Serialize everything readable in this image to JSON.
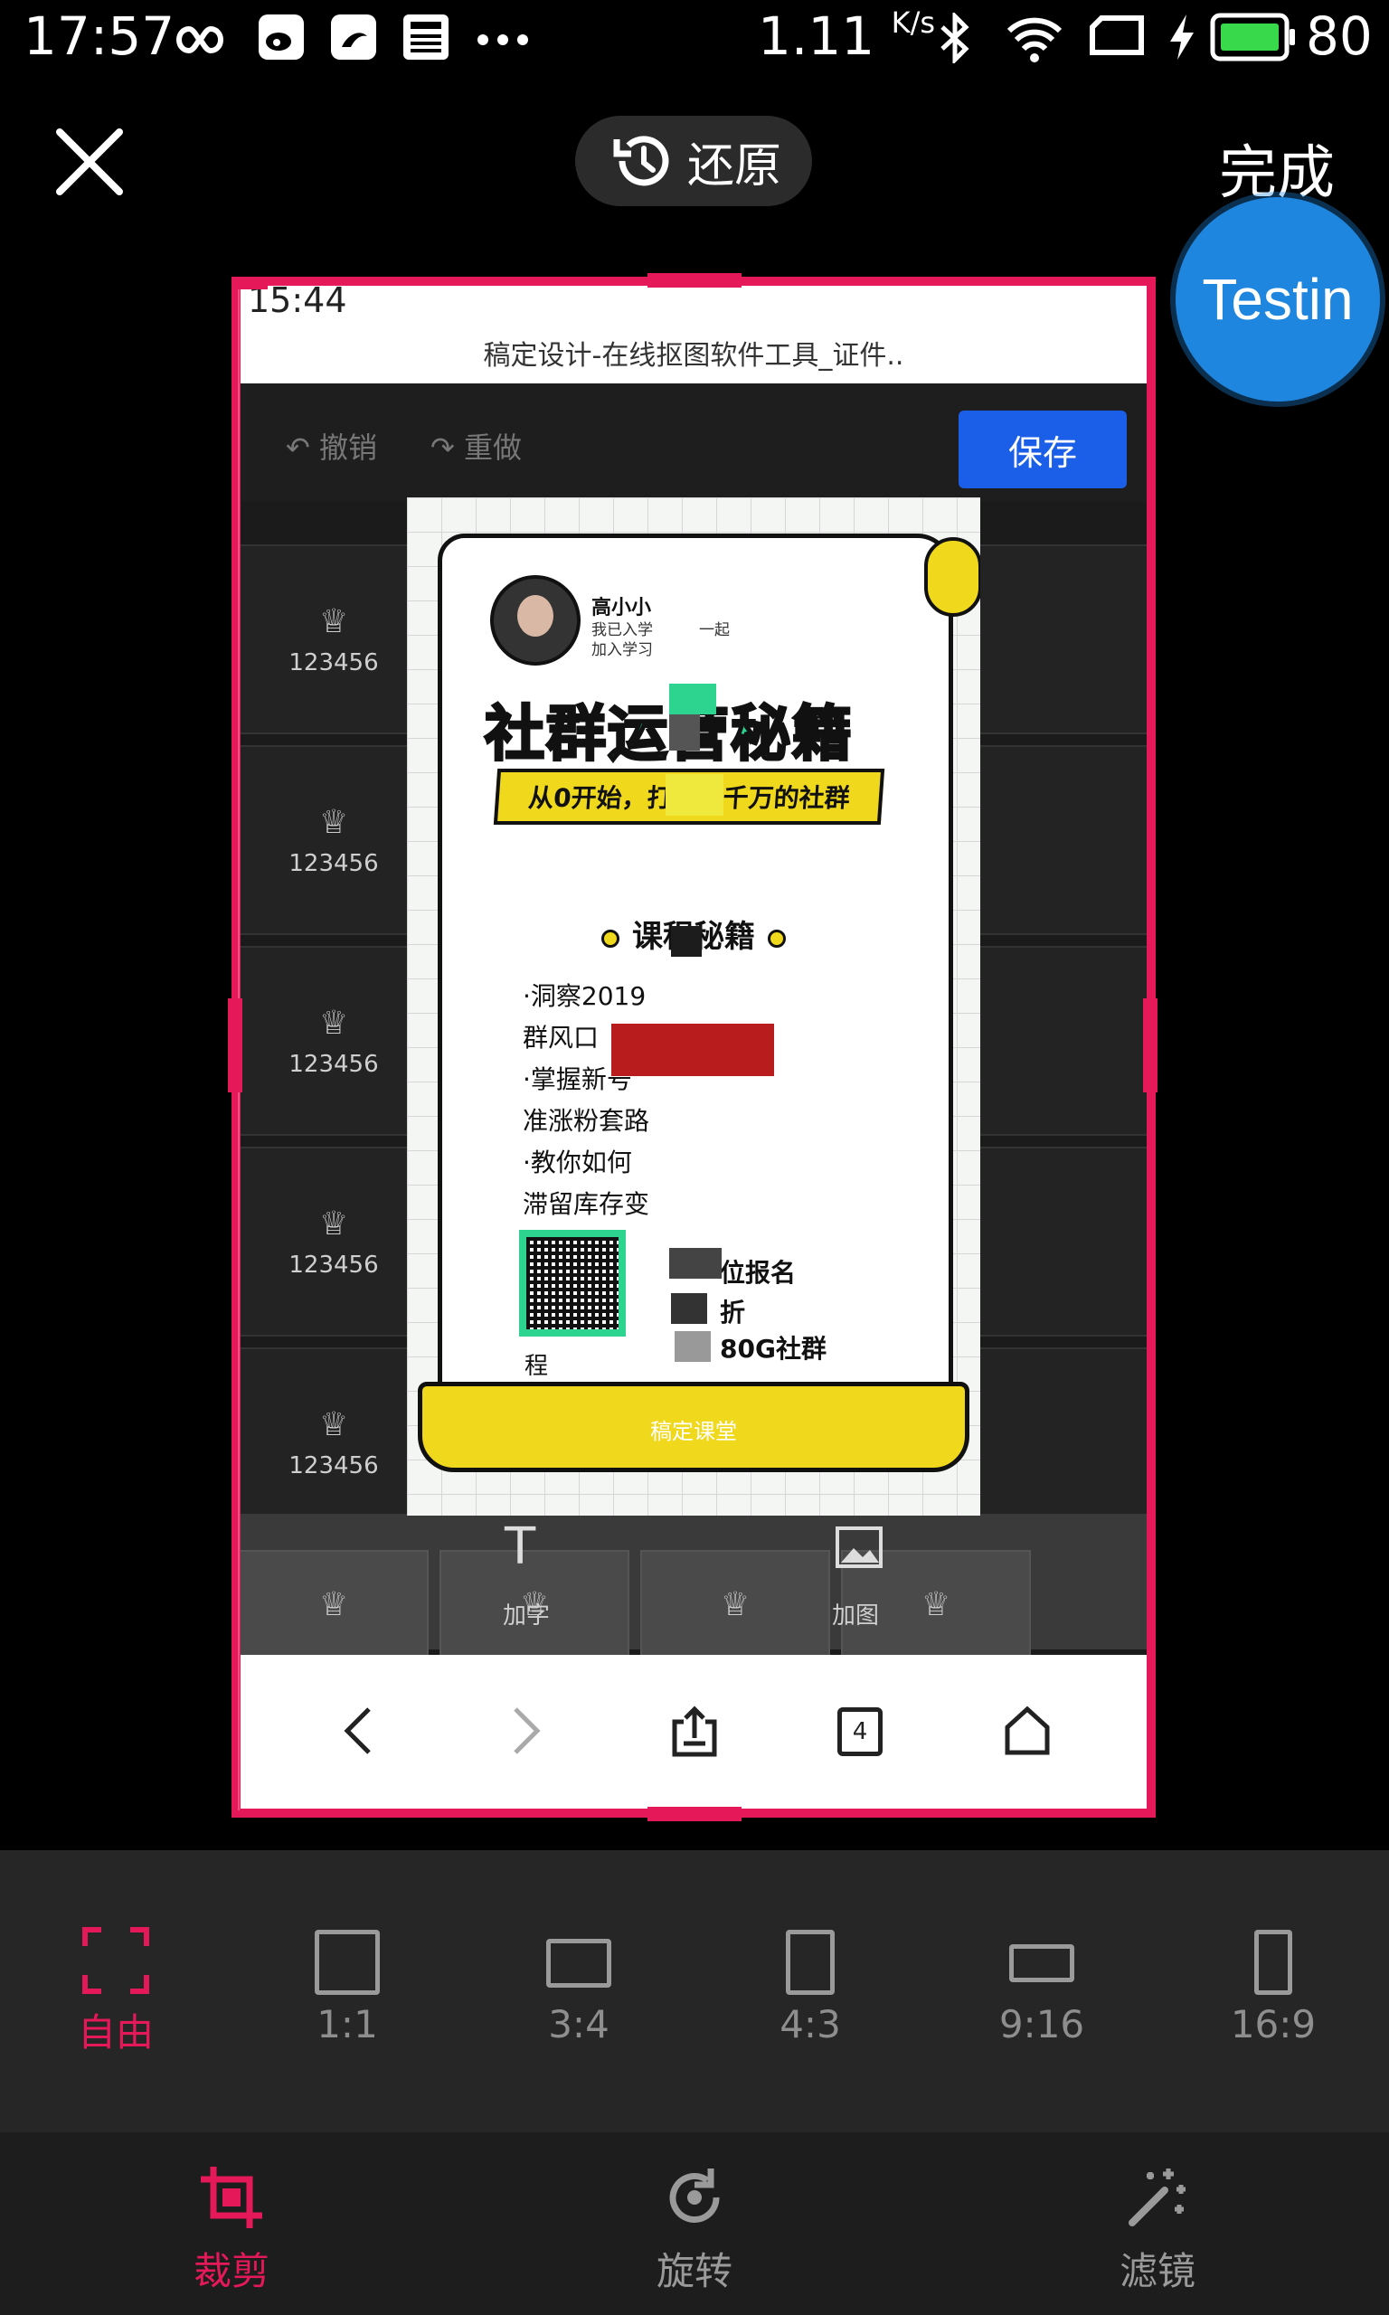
{
  "status_bar": {
    "time": "17:57",
    "speed": "1.11",
    "speed_unit": "K/s",
    "battery": "80",
    "icons": [
      "infinity-icon",
      "weibo-icon",
      "uc-browser-icon",
      "news-icon",
      "more-dots-icon",
      "bluetooth-icon",
      "wifi-icon",
      "screen-rotate-icon",
      "charging-icon",
      "battery-icon"
    ]
  },
  "top_bar": {
    "close_icon": "close-icon",
    "restore_label": "还原",
    "done_label": "完成",
    "floating_badge": "Testin"
  },
  "image": {
    "inner_status_time": "15:44",
    "inner_title": "稿定设计-在线抠图软件工具_证件..",
    "undo_label": "撤销",
    "redo_label": "重做",
    "save_label": "保存",
    "tile_caption": "123456",
    "tool_text_label": "加字",
    "tool_image_label": "加图",
    "nav_tab_count": "4",
    "poster": {
      "user_name": "高小小",
      "user_line1": "我已入学　　　一起",
      "user_line2": "加入学习",
      "title": "社群运营秘籍",
      "banner": "从0开始，打造百千万的社群",
      "section": "课程秘籍",
      "lines": [
        "·洞察2019",
        "群风口",
        "·掌握新号",
        "准涨粉套路",
        "·教你如何",
        "滞留库存变"
      ],
      "enroll": "位报名",
      "discount": "折",
      "gift": "80G社群",
      "cheng": "程",
      "footer": "稿定课堂"
    }
  },
  "ratio_bar": {
    "items": [
      {
        "label": "自由",
        "active": true
      },
      {
        "label": "1:1",
        "active": false
      },
      {
        "label": "3:4",
        "active": false
      },
      {
        "label": "4:3",
        "active": false
      },
      {
        "label": "9:16",
        "active": false
      },
      {
        "label": "16:9",
        "active": false
      }
    ]
  },
  "tab_bar": {
    "crop": "裁剪",
    "rotate": "旋转",
    "filter": "滤镜"
  },
  "colors": {
    "accent": "#e5195a",
    "background": "#000000",
    "ratio_bar_bg": "#262626",
    "tab_bar_bg": "#1d1d1d",
    "save_button": "#1b5fe8",
    "badge": "#1f86df",
    "poster_green": "#2dd48f",
    "poster_yellow": "#f0d81c"
  }
}
